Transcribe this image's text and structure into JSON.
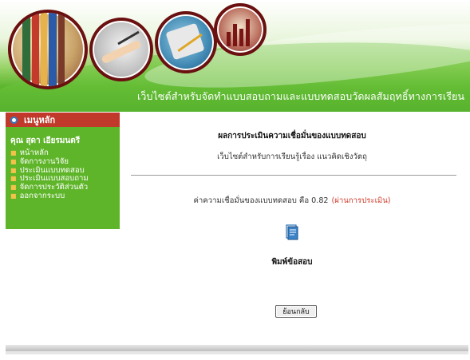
{
  "banner": {
    "title": "เว็บไซต์สำหรับจัดทำแบบสอบถามและแบบทดสอบวัดผลสัมฤทธิ์ทางการเรียน"
  },
  "sidebar": {
    "header": "เมนูหลัก",
    "user": "คุณ สุดา เอียรมนตรี",
    "items": [
      {
        "label": "หน้าหลัก"
      },
      {
        "label": "จัดการงานวิจัย"
      },
      {
        "label": "ประเมินแบบทดสอบ"
      },
      {
        "label": "ประเมินแบบสอบถาม"
      },
      {
        "label": "จัดการประวัติส่วนตัว"
      },
      {
        "label": "ออกจากระบบ"
      }
    ]
  },
  "main": {
    "result_title": "ผลการประเมินความเชื่อมั่นของแบบทดสอบ",
    "subtitle": "เว็บไซต์สำหรับการเรียนรู้เรื่อง แนวคิดเชิงวัตถุ",
    "reliability_text": "ค่าความเชื่อมั่นของแบบทดสอบ คือ 0.82",
    "reliability_status": "(ผ่านการประเมิน)",
    "print_label": "พิมพ์ข้อสอบ",
    "back_button": "ย้อนกลับ"
  },
  "colors": {
    "header_red": "#c0392b",
    "sidebar_green": "#5fb52a",
    "status_red": "#d13b2b"
  }
}
